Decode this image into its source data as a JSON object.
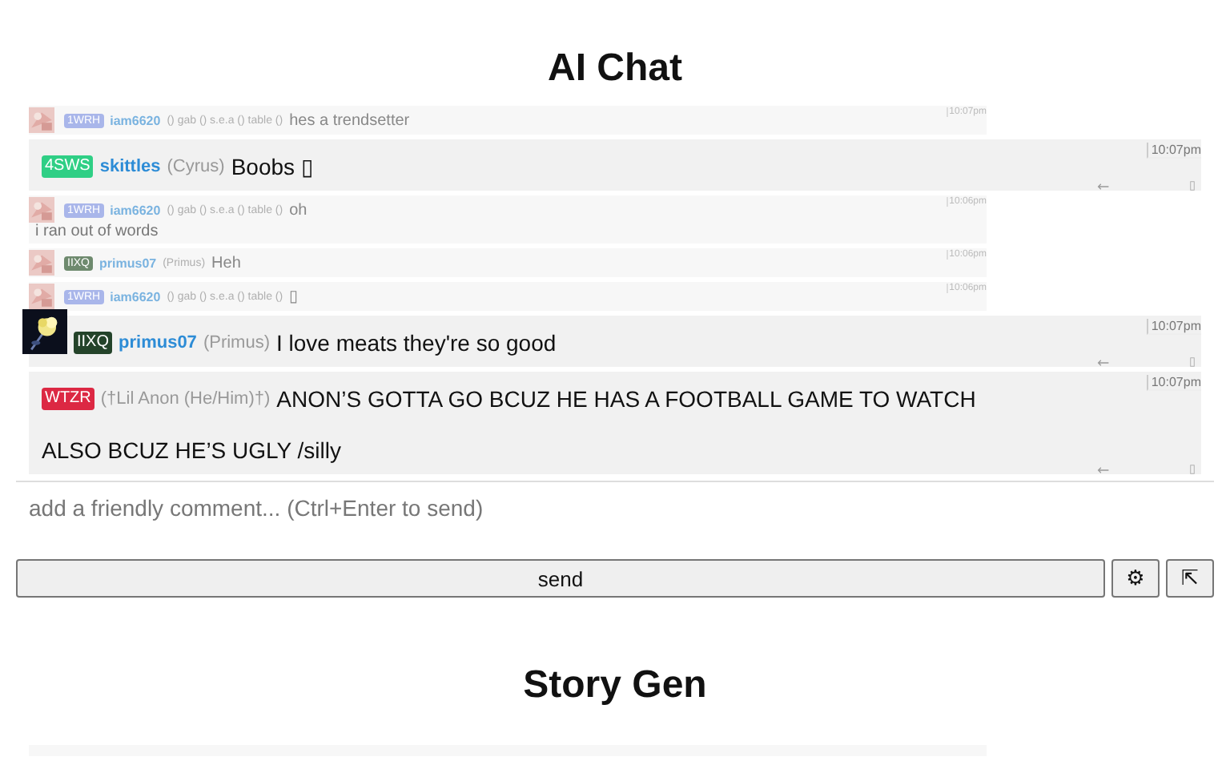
{
  "sections": [
    {
      "title": "AI Chat",
      "messages": [
        {
          "kind": "compact",
          "tag": "1WRH",
          "color": "#a9b6ea",
          "name": "iam6620",
          "meta": "() gab () s.e.a () table ()",
          "text": "hes a trendsetter",
          "time": "10:07pm"
        },
        {
          "kind": "full",
          "tag": "4SWS",
          "color": "#2fcf85",
          "name": "skittles",
          "nick": "(Cyrus)",
          "lines": [
            "Boobs ▯"
          ],
          "time": "10:07pm",
          "avatar": false
        },
        {
          "kind": "compact",
          "tag": "1WRH",
          "color": "#a9b6ea",
          "name": "iam6620",
          "meta": "() gab () s.e.a () table ()",
          "text": "oh",
          "more": "i ran out of words",
          "time": "10:06pm"
        },
        {
          "kind": "compact",
          "tag": "IIXQ",
          "color": "#6e8a6e",
          "name": "primus07",
          "meta": "(Primus)",
          "text": "Heh",
          "time": "10:06pm"
        },
        {
          "kind": "compact",
          "tag": "1WRH",
          "color": "#a9b6ea",
          "name": "iam6620",
          "meta": "() gab () s.e.a () table ()",
          "text": "▯",
          "time": "10:06pm"
        },
        {
          "kind": "full",
          "tag": "IIXQ",
          "color": "#24432a",
          "name": "primus07",
          "nick": "(Primus)",
          "lines": [
            "I love meats they're so good"
          ],
          "time": "10:07pm",
          "avatar": true
        },
        {
          "kind": "full",
          "tag": "WTZR",
          "color": "#dc2843",
          "nick": "(†Lil Anon (He/Him)†)",
          "lines": [
            "ANON’S GOTTA GO BCUZ HE HAS A FOOTBALL GAME TO WATCH",
            "ALSO BCUZ HE’S UGLY /silly"
          ],
          "time": "10:07pm",
          "avatar": false
        }
      ],
      "composer": {
        "placeholder": "add a friendly comment... (Ctrl+Enter to send)",
        "send": "send",
        "settings": "⚙",
        "expand": "⇱"
      }
    },
    {
      "title": "Story Gen",
      "preview_row": true
    }
  ]
}
